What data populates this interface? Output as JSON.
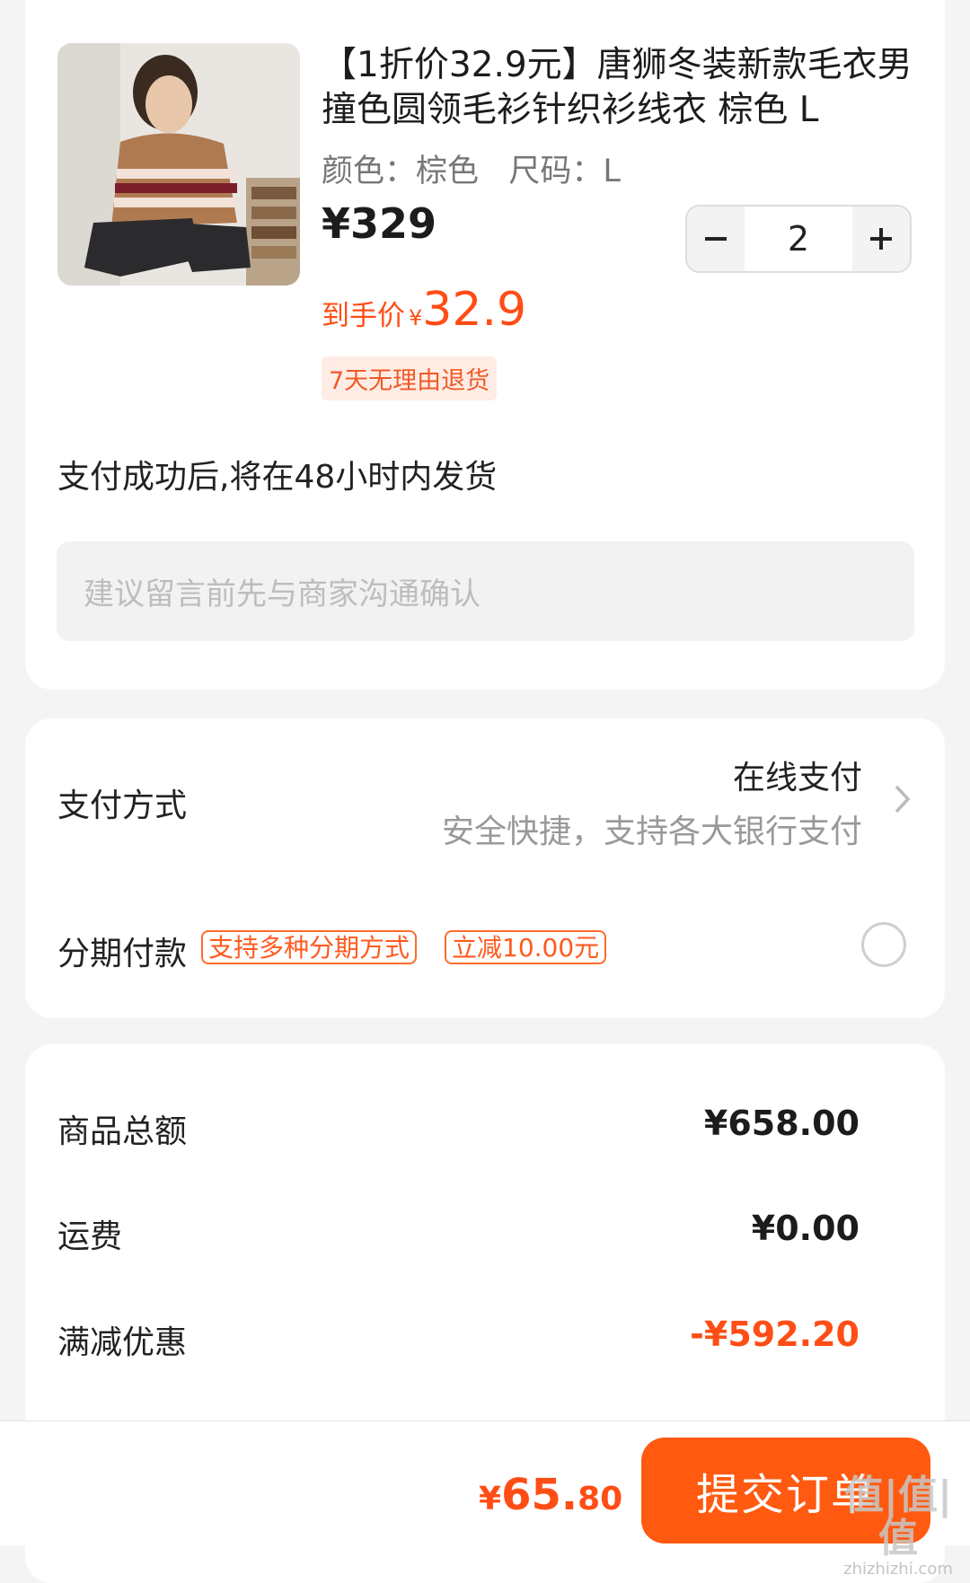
{
  "product": {
    "title": "【1折价32.9元】唐狮冬装新款毛衣男撞色圆领毛衫针织衫线衣 棕色 L",
    "specs": "颜色：棕色   尺码：L",
    "price": "¥329",
    "quantity": "2",
    "final_price_label": "到手价",
    "final_price_currency": "¥",
    "final_price_value": "32.9",
    "return_policy": "7天无理由退货",
    "image_icon": "product-photo"
  },
  "shipping_note": "支付成功后,将在48小时内发货",
  "message": {
    "placeholder": "建议留言前先与商家沟通确认"
  },
  "payment": {
    "label": "支付方式",
    "method": "在线支付",
    "method_desc": "安全快捷，支持各大银行支付",
    "installment_label": "分期付款",
    "installment_tag": "支持多种分期方式",
    "discount_tag": "立减10.00元"
  },
  "totals": {
    "subtotal_label": "商品总额",
    "subtotal_value": "¥658.00",
    "shipping_label": "运费",
    "shipping_value": "¥0.00",
    "discount_label": "满减优惠",
    "discount_value": "-¥592.20"
  },
  "footer": {
    "total_currency": "¥",
    "total_integer": "65.",
    "total_decimal": "80",
    "submit_label": "提交订单"
  },
  "watermark": {
    "text": "值|值|值",
    "domain": "zhizhizhi.com"
  },
  "colors": {
    "accent": "#ff4d16",
    "button": "#ff5a10",
    "badge_bg": "#ffece4"
  }
}
